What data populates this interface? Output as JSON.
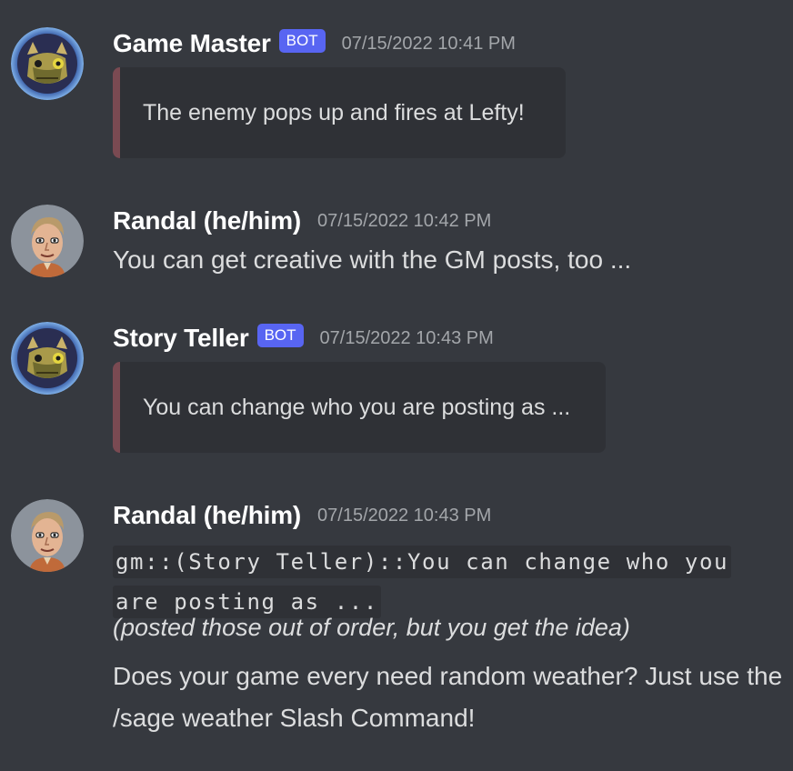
{
  "messages": [
    {
      "author": "Game Master",
      "bot_tag": "BOT",
      "timestamp": "07/15/2022 10:41 PM",
      "embed_text": "The enemy pops up and fires at Lefty!"
    },
    {
      "author": "Randal (he/him)",
      "timestamp": "07/15/2022 10:42 PM",
      "text": "You can get creative with the GM posts, too ..."
    },
    {
      "author": "Story Teller",
      "bot_tag": "BOT",
      "timestamp": "07/15/2022 10:43 PM",
      "embed_text": "You can change who you are posting as ..."
    },
    {
      "author": "Randal (he/him)",
      "timestamp": "07/15/2022 10:43 PM",
      "code": "gm::(Story Teller)::You can change who you are posting as ...",
      "italic_note": "(posted those out of order, but you get the idea)",
      "text": "Does your game every need random weather? Just use the /sage weather Slash Command!"
    }
  ],
  "colors": {
    "background": "#36393f",
    "embed_background": "#2f3136",
    "embed_border": "#7a4a52",
    "bot_tag": "#5865f2",
    "timestamp": "#a3a6aa",
    "text": "#dcddde",
    "author": "#ffffff"
  },
  "icons": {
    "bot_avatar": "dragon-avatar-icon",
    "user_avatar": "man-portrait-avatar-icon"
  }
}
